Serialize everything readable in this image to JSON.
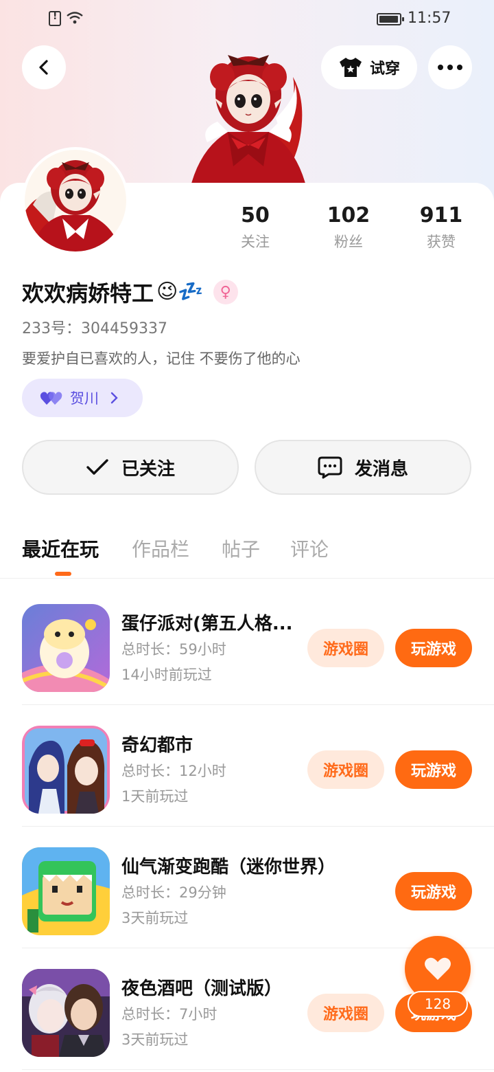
{
  "status_bar": {
    "time": "11:57"
  },
  "header": {
    "try_on_label": "试穿"
  },
  "profile": {
    "stats": [
      {
        "value": "50",
        "label": "关注"
      },
      {
        "value": "102",
        "label": "粉丝"
      },
      {
        "value": "911",
        "label": "获赞"
      }
    ],
    "name": "欢欢病娇特工",
    "name_emojis": "😉💤",
    "gender_symbol": "♀",
    "uid": "233号：304459337",
    "bio": "要爱护自已喜欢的人，记住 不要伤了他的心",
    "cp_tag": "贺川"
  },
  "actions": {
    "follow_label": "已关注",
    "message_label": "发消息"
  },
  "tabs": [
    "最近在玩",
    "作品栏",
    "帖子",
    "评论"
  ],
  "games": [
    {
      "title": "蛋仔派对(第五人格...",
      "duration": "总时长：59小时",
      "last_played": "14小时前玩过",
      "circle_label": "游戏圈",
      "play_label": "玩游戏"
    },
    {
      "title": "奇幻都市",
      "duration": "总时长：12小时",
      "last_played": "1天前玩过",
      "circle_label": "游戏圈",
      "play_label": "玩游戏"
    },
    {
      "title": "仙气渐变跑酷（迷你世界）",
      "duration": "总时长：29分钟",
      "last_played": "3天前玩过",
      "circle_label": "",
      "play_label": "玩游戏"
    },
    {
      "title": "夜色酒吧（测试版）",
      "duration": "总时长：7小时",
      "last_played": "3天前玩过",
      "circle_label": "游戏圈",
      "play_label": "玩游戏"
    }
  ],
  "like_fab": {
    "count": "128"
  },
  "colors": {
    "accent": "#ff6a12",
    "accent_light": "#ffe9dc",
    "cp_bg": "#ebe8fd",
    "cp_text": "#5b4fe0"
  }
}
